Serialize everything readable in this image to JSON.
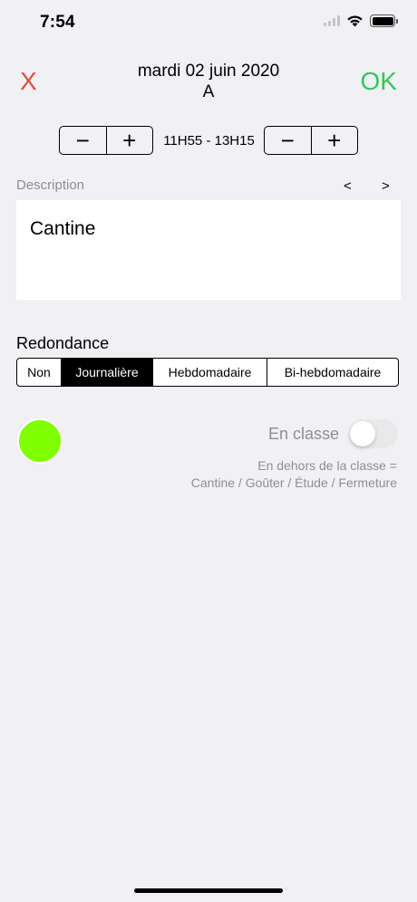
{
  "status_bar": {
    "time": "7:54",
    "icons": [
      "signal-icon",
      "wifi-icon",
      "battery-icon"
    ]
  },
  "header": {
    "cancel_label": "X",
    "ok_label": "OK",
    "date": "mardi 02 juin 2020",
    "subtitle": "A",
    "colors": {
      "cancel": "#e74c3c",
      "ok": "#34c759"
    }
  },
  "time": {
    "minus_label": "−",
    "plus_label": "+",
    "range": "11H55 - 13H15"
  },
  "description": {
    "label": "Description",
    "prev_label": "<",
    "next_label": ">",
    "value": "Cantine"
  },
  "redondance": {
    "label": "Redondance",
    "options": [
      "Non",
      "Journalière",
      "Hebdomadaire",
      "Bi-hebdomadaire"
    ],
    "selected": "Journalière"
  },
  "color": {
    "value": "#7fff00"
  },
  "en_classe": {
    "label": "En classe",
    "on": false,
    "hint_line1": "En dehors de la classe =",
    "hint_line2": "Cantine / Goûter / Étude / Fermeture"
  }
}
